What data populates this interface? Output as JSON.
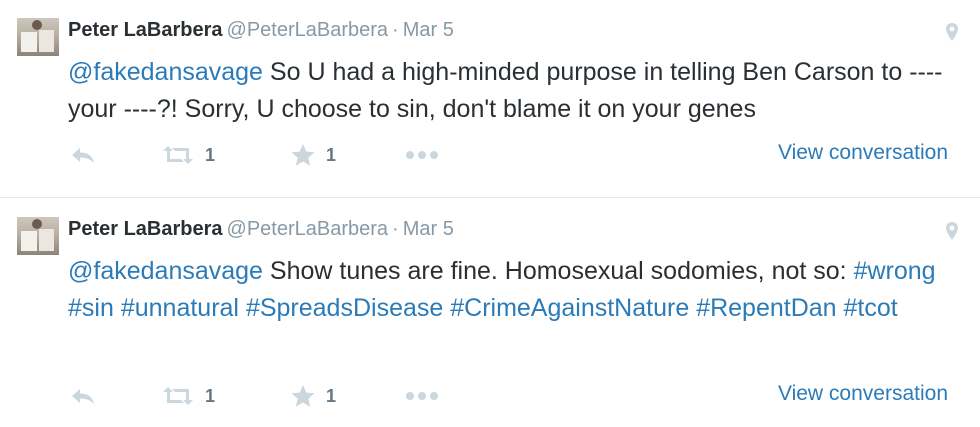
{
  "tweets": [
    {
      "fullname": "Peter LaBarbera",
      "handle": "@PeterLaBarbera",
      "dot": "·",
      "date": "Mar 5",
      "mention": "@fakedansavage",
      "text": " So U had a high-minded purpose in telling Ben Carson to ---- your ----?! Sorry, U choose to sin, don't blame it on your genes",
      "retweet_count": "1",
      "favorite_count": "1",
      "view_conversation": "View conversation"
    },
    {
      "fullname": "Peter LaBarbera",
      "handle": "@PeterLaBarbera",
      "dot": "·",
      "date": "Mar 5",
      "mention": "@fakedansavage",
      "text": " Show tunes are fine. Homosexual sodomies, not so: ",
      "hashtags": [
        "#wrong",
        "#sin",
        "#unnatural",
        "#SpreadsDisease",
        "#CrimeAgainstNature",
        "#RepentDan",
        "#tcot"
      ],
      "retweet_count": "1",
      "favorite_count": "1",
      "view_conversation": "View conversation"
    }
  ],
  "icons": {
    "reply": "reply-icon",
    "retweet": "retweet-icon",
    "favorite": "star-icon",
    "more": "more-dots-icon",
    "location": "location-pin-icon"
  },
  "colors": {
    "link": "#2b7bb9",
    "muted": "#8899a6",
    "text": "#292f33",
    "divider": "#e1e8ed"
  }
}
